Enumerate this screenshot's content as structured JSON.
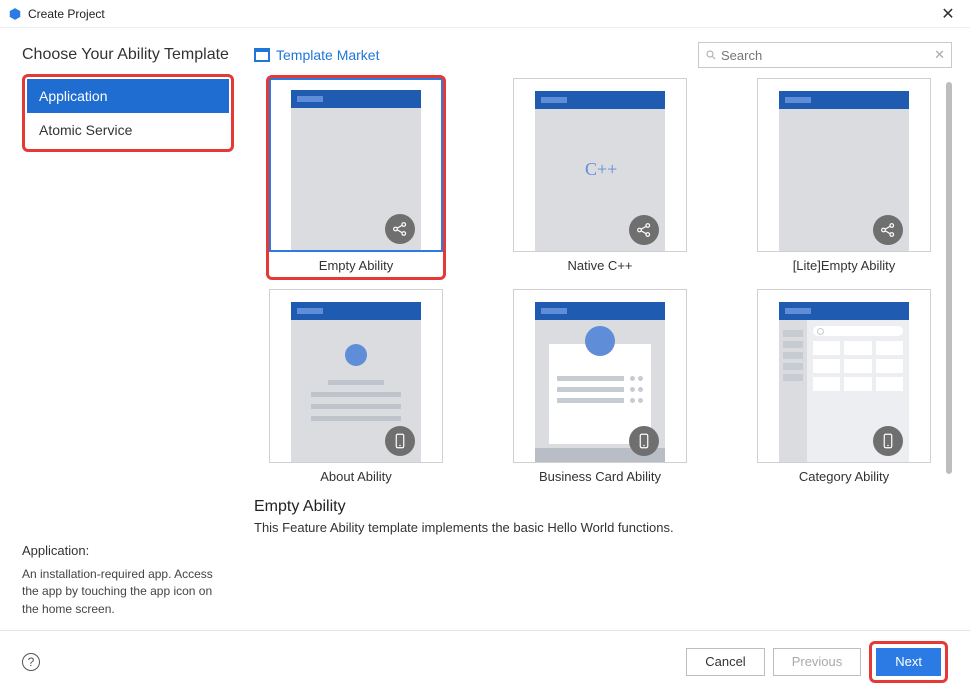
{
  "window": {
    "title": "Create Project"
  },
  "heading": "Choose Your Ability Template",
  "sidebar": {
    "tabs": [
      {
        "label": "Application",
        "selected": true
      },
      {
        "label": "Atomic Service",
        "selected": false
      }
    ],
    "info": {
      "title": "Application:",
      "desc": "An installation-required app. Access the app by touching the app icon on the home screen."
    }
  },
  "market_link": "Template Market",
  "search": {
    "placeholder": "Search"
  },
  "templates": [
    {
      "id": "empty",
      "label": "Empty Ability",
      "selected": true,
      "highlight": true,
      "badge": "share"
    },
    {
      "id": "native",
      "label": "Native C++",
      "selected": false,
      "highlight": false,
      "badge": "share",
      "cpp": "C++"
    },
    {
      "id": "lite",
      "label": "[Lite]Empty Ability",
      "selected": false,
      "highlight": false,
      "badge": "share"
    },
    {
      "id": "about",
      "label": "About Ability",
      "selected": false,
      "highlight": false,
      "badge": "phone"
    },
    {
      "id": "bizcard",
      "label": "Business Card Ability",
      "selected": false,
      "highlight": false,
      "badge": "phone"
    },
    {
      "id": "category",
      "label": "Category Ability",
      "selected": false,
      "highlight": false,
      "badge": "phone"
    }
  ],
  "description": {
    "title": "Empty Ability",
    "text": "This Feature Ability template implements the basic Hello World functions."
  },
  "footer": {
    "cancel": "Cancel",
    "previous": "Previous",
    "next": "Next"
  }
}
